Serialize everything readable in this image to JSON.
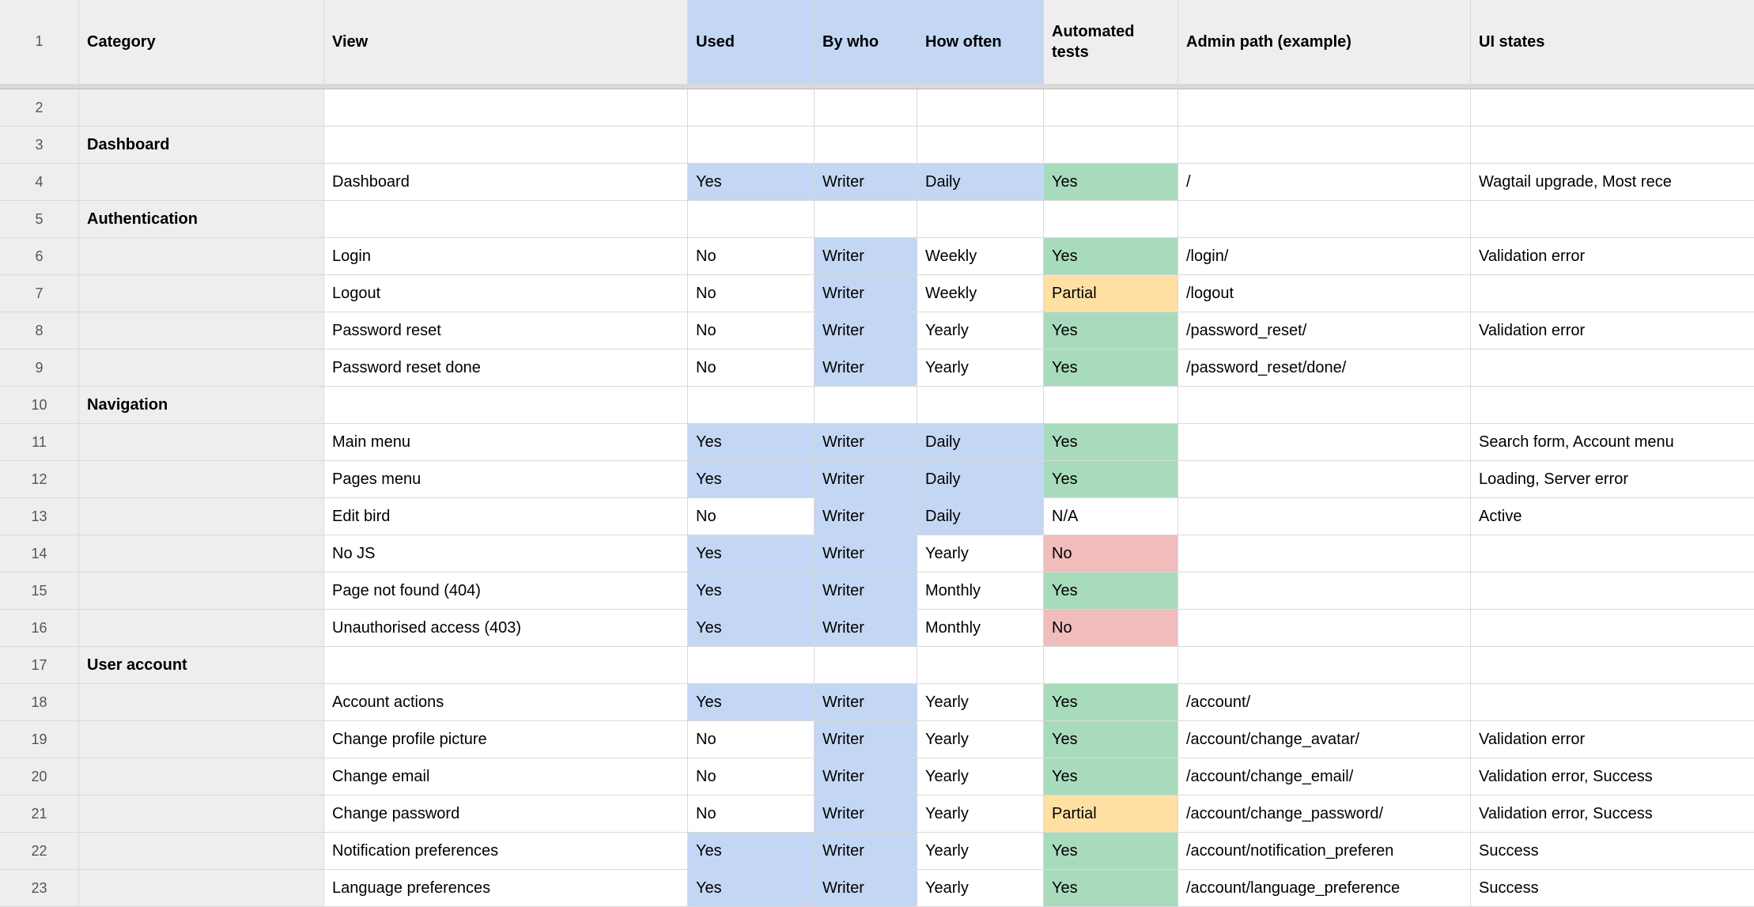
{
  "headers": {
    "category": "Category",
    "view": "View",
    "used": "Used",
    "bywho": "By who",
    "howoften": "How often",
    "tests": "Automated tests",
    "path": "Admin path (example)",
    "states": "UI states"
  },
  "colors": {
    "headerBg": "#eeeeee",
    "highlightBlue": "#c3d7f5",
    "green": "#a8dbbc",
    "yellow": "#ffe0a3",
    "red": "#f0bcbc"
  },
  "rows": [
    {
      "num": "1"
    },
    {
      "num": "2",
      "category": "",
      "view": "",
      "used": "",
      "bywho": "",
      "howoften": "",
      "tests": "",
      "path": "",
      "states": ""
    },
    {
      "num": "3",
      "category": "Dashboard",
      "view": "",
      "used": "",
      "bywho": "",
      "howoften": "",
      "tests": "",
      "path": "",
      "states": ""
    },
    {
      "num": "4",
      "category": "",
      "view": "Dashboard",
      "used": "Yes",
      "bywho": "Writer",
      "howoften": "Daily",
      "tests": "Yes",
      "path": "/",
      "states": "Wagtail upgrade, Most rece"
    },
    {
      "num": "5",
      "category": "Authentication",
      "view": "",
      "used": "",
      "bywho": "",
      "howoften": "",
      "tests": "",
      "path": "",
      "states": ""
    },
    {
      "num": "6",
      "category": "",
      "view": "Login",
      "used": "No",
      "bywho": "Writer",
      "howoften": "Weekly",
      "tests": "Yes",
      "path": "/login/",
      "states": "Validation error"
    },
    {
      "num": "7",
      "category": "",
      "view": "Logout",
      "used": "No",
      "bywho": "Writer",
      "howoften": "Weekly",
      "tests": "Partial",
      "path": "/logout",
      "states": ""
    },
    {
      "num": "8",
      "category": "",
      "view": "Password reset",
      "used": "No",
      "bywho": "Writer",
      "howoften": "Yearly",
      "tests": "Yes",
      "path": "/password_reset/",
      "states": "Validation error"
    },
    {
      "num": "9",
      "category": "",
      "view": "Password reset done",
      "used": "No",
      "bywho": "Writer",
      "howoften": "Yearly",
      "tests": "Yes",
      "path": "/password_reset/done/",
      "states": ""
    },
    {
      "num": "10",
      "category": "Navigation",
      "view": "",
      "used": "",
      "bywho": "",
      "howoften": "",
      "tests": "",
      "path": "",
      "states": ""
    },
    {
      "num": "11",
      "category": "",
      "view": "Main menu",
      "used": "Yes",
      "bywho": "Writer",
      "howoften": "Daily",
      "tests": "Yes",
      "path": "",
      "states": "Search form, Account menu"
    },
    {
      "num": "12",
      "category": "",
      "view": "Pages menu",
      "used": "Yes",
      "bywho": "Writer",
      "howoften": "Daily",
      "tests": "Yes",
      "path": "",
      "states": "Loading, Server error"
    },
    {
      "num": "13",
      "category": "",
      "view": "Edit bird",
      "used": "No",
      "bywho": "Writer",
      "howoften": "Daily",
      "tests": "N/A",
      "path": "",
      "states": "Active"
    },
    {
      "num": "14",
      "category": "",
      "view": "No JS",
      "used": "Yes",
      "bywho": "Writer",
      "howoften": "Yearly",
      "tests": "No",
      "path": "",
      "states": ""
    },
    {
      "num": "15",
      "category": "",
      "view": "Page not found (404)",
      "used": "Yes",
      "bywho": "Writer",
      "howoften": "Monthly",
      "tests": "Yes",
      "path": "",
      "states": ""
    },
    {
      "num": "16",
      "category": "",
      "view": "Unauthorised access (403)",
      "used": "Yes",
      "bywho": "Writer",
      "howoften": "Monthly",
      "tests": "No",
      "path": "",
      "states": ""
    },
    {
      "num": "17",
      "category": "User account",
      "view": "",
      "used": "",
      "bywho": "",
      "howoften": "",
      "tests": "",
      "path": "",
      "states": ""
    },
    {
      "num": "18",
      "category": "",
      "view": "Account actions",
      "used": "Yes",
      "bywho": "Writer",
      "howoften": "Yearly",
      "tests": "Yes",
      "path": "/account/",
      "states": ""
    },
    {
      "num": "19",
      "category": "",
      "view": "Change profile picture",
      "used": "No",
      "bywho": "Writer",
      "howoften": "Yearly",
      "tests": "Yes",
      "path": "/account/change_avatar/",
      "states": "Validation error"
    },
    {
      "num": "20",
      "category": "",
      "view": "Change email",
      "used": "No",
      "bywho": "Writer",
      "howoften": "Yearly",
      "tests": "Yes",
      "path": "/account/change_email/",
      "states": "Validation error, Success"
    },
    {
      "num": "21",
      "category": "",
      "view": "Change password",
      "used": "No",
      "bywho": "Writer",
      "howoften": "Yearly",
      "tests": "Partial",
      "path": "/account/change_password/",
      "states": "Validation error, Success"
    },
    {
      "num": "22",
      "category": "",
      "view": "Notification preferences",
      "used": "Yes",
      "bywho": "Writer",
      "howoften": "Yearly",
      "tests": "Yes",
      "path": "/account/notification_preferen",
      "states": "Success"
    },
    {
      "num": "23",
      "category": "",
      "view": "Language preferences",
      "used": "Yes",
      "bywho": "Writer",
      "howoften": "Yearly",
      "tests": "Yes",
      "path": "/account/language_preference",
      "states": "Success"
    }
  ]
}
